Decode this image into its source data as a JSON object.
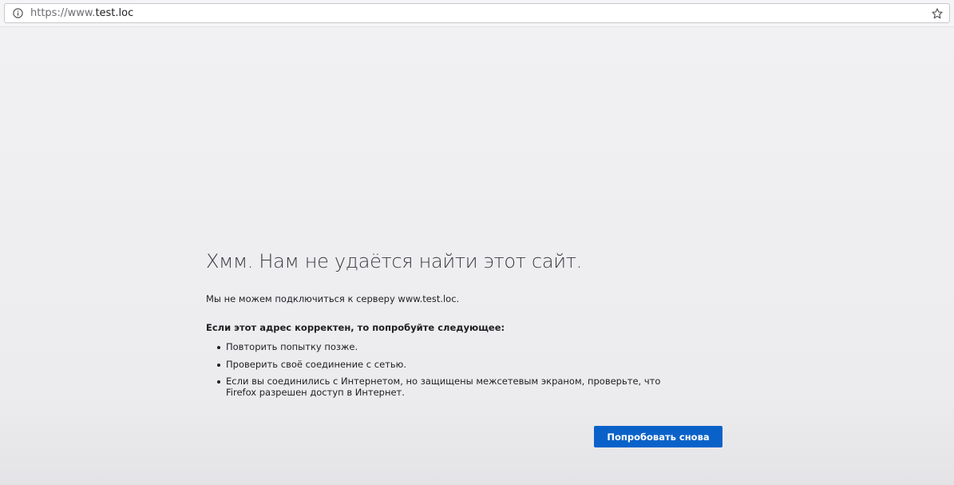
{
  "urlbar": {
    "info_icon": "info-circle-icon",
    "url_scheme": "https://www.",
    "url_host": "test.loc",
    "bookmark_icon": "star-icon"
  },
  "error": {
    "title": "Хмм. Нам не удаётся найти этот сайт.",
    "description": "Мы не можем подключиться к серверу www.test.loc.",
    "subheading": "Если этот адрес корректен, то попробуйте следующее:",
    "tips": [
      "Повторить попытку позже.",
      "Проверить своё соединение с сетью.",
      "Если вы соединились с Интернетом, но защищены межсетевым экраном, проверьте, что Firefox разрешен доступ в Интернет."
    ],
    "retry_label": "Попробовать снова"
  },
  "colors": {
    "button": "#0a62c9",
    "background": "#f0f0f2"
  }
}
